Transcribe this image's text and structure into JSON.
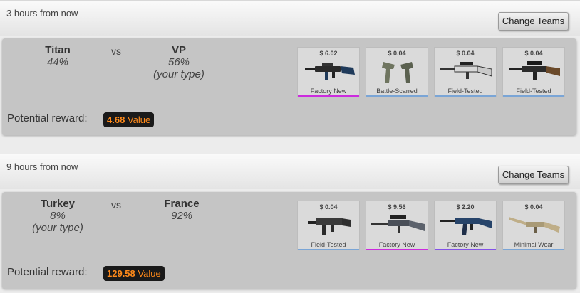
{
  "matches": [
    {
      "time": "3 hours from now",
      "change_label": "Change Teams",
      "team1": {
        "name": "Titan",
        "pct": "44%",
        "note": ""
      },
      "vs": "vs",
      "team2": {
        "name": "VP",
        "pct": "56%",
        "note": "(your type)"
      },
      "reward_label": "Potential reward:",
      "reward_value": "4.68",
      "reward_unit": "Value",
      "items": [
        {
          "price": "$ 6.02",
          "wear": "Factory New",
          "bar_color": "#cc2bde",
          "icon": "rifle-m4a1s-icon"
        },
        {
          "price": "$ 0.04",
          "wear": "Battle-Scarred",
          "bar_color": "#7aa5d6",
          "icon": "dual-pistols-icon"
        },
        {
          "price": "$ 0.04",
          "wear": "Field-Tested",
          "bar_color": "#7aa5d6",
          "icon": "sniper-rifle-icon"
        },
        {
          "price": "$ 0.04",
          "wear": "Field-Tested",
          "bar_color": "#7aa5d6",
          "icon": "auto-sniper-icon"
        }
      ]
    },
    {
      "time": "9 hours from now",
      "change_label": "Change Teams",
      "team1": {
        "name": "Turkey",
        "pct": "8%",
        "note": "(your type)"
      },
      "vs": "vs",
      "team2": {
        "name": "France",
        "pct": "92%",
        "note": ""
      },
      "reward_label": "Potential reward:",
      "reward_value": "129.58",
      "reward_unit": "Value",
      "items": [
        {
          "price": "$ 0.04",
          "wear": "Field-Tested",
          "bar_color": "#7aa5d6",
          "icon": "smg-ump-icon"
        },
        {
          "price": "$ 9.56",
          "wear": "Factory New",
          "bar_color": "#cc2bde",
          "icon": "awp-sniper-icon"
        },
        {
          "price": "$ 2.20",
          "wear": "Factory New",
          "bar_color": "#8452e8",
          "icon": "ak47-rifle-icon"
        },
        {
          "price": "$ 0.04",
          "wear": "Minimal Wear",
          "bar_color": "#7aa5d6",
          "icon": "shotgun-icon"
        }
      ]
    }
  ]
}
